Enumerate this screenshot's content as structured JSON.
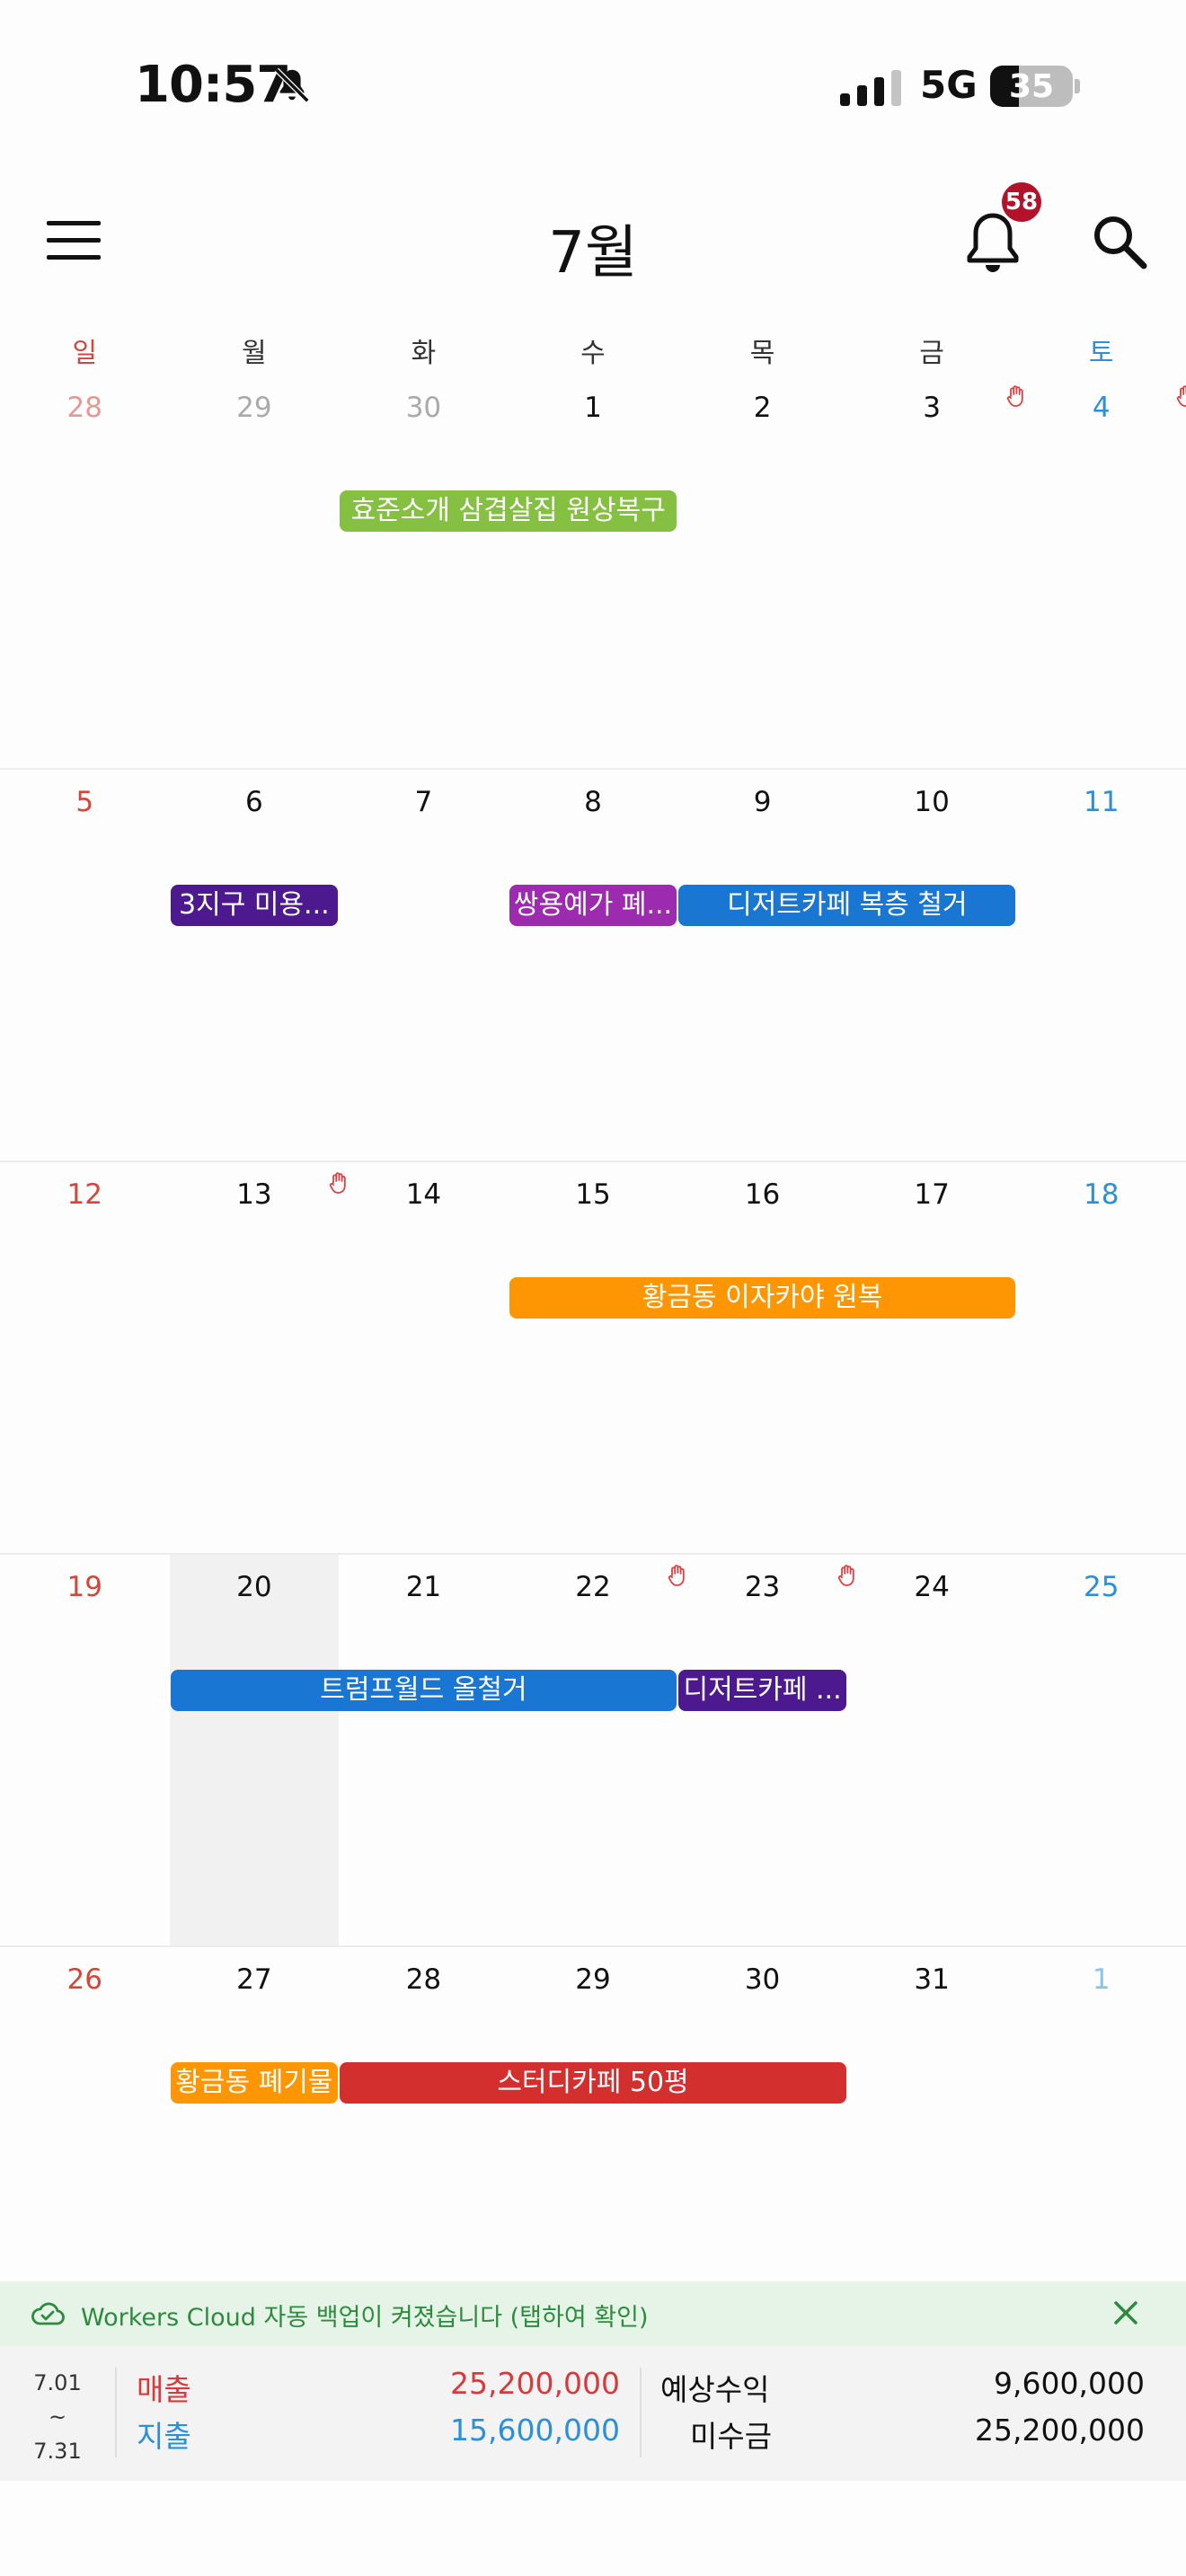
{
  "status_bar": {
    "time": "10:57",
    "network": "5G",
    "battery": "35",
    "battery_level": 0.35
  },
  "header": {
    "month": "7월",
    "notification_count": "58"
  },
  "weekdays": [
    "일",
    "월",
    "화",
    "수",
    "목",
    "금",
    "토"
  ],
  "weeks": [
    {
      "days": [
        {
          "num": "28",
          "other": true
        },
        {
          "num": "29",
          "other": true
        },
        {
          "num": "30",
          "other": true
        },
        {
          "num": "1"
        },
        {
          "num": "2"
        },
        {
          "num": "3",
          "hand": true
        },
        {
          "num": "4",
          "hand": true
        }
      ]
    },
    {
      "days": [
        {
          "num": "5"
        },
        {
          "num": "6"
        },
        {
          "num": "7"
        },
        {
          "num": "8"
        },
        {
          "num": "9"
        },
        {
          "num": "10"
        },
        {
          "num": "11"
        }
      ]
    },
    {
      "days": [
        {
          "num": "12"
        },
        {
          "num": "13",
          "hand": true
        },
        {
          "num": "14"
        },
        {
          "num": "15"
        },
        {
          "num": "16"
        },
        {
          "num": "17"
        },
        {
          "num": "18"
        }
      ]
    },
    {
      "days": [
        {
          "num": "19"
        },
        {
          "num": "20",
          "today": true
        },
        {
          "num": "21"
        },
        {
          "num": "22",
          "hand": true
        },
        {
          "num": "23",
          "hand": true
        },
        {
          "num": "24"
        },
        {
          "num": "25"
        }
      ]
    },
    {
      "days": [
        {
          "num": "26"
        },
        {
          "num": "27"
        },
        {
          "num": "28"
        },
        {
          "num": "29"
        },
        {
          "num": "30"
        },
        {
          "num": "31"
        },
        {
          "num": "1",
          "other": true
        }
      ]
    }
  ],
  "events": [
    {
      "title": "효준소개 삼겹살집 원상복구",
      "week": 0,
      "start": 2,
      "span": 2,
      "color": "#86c043"
    },
    {
      "title": "3지구 미용...",
      "week": 1,
      "start": 1,
      "span": 1,
      "color": "#4c1a8e"
    },
    {
      "title": "쌍용예가 폐...",
      "week": 1,
      "start": 3,
      "span": 1,
      "color": "#9c2bb0"
    },
    {
      "title": "디저트카페 복층 철거",
      "week": 1,
      "start": 4,
      "span": 2,
      "color": "#1976d2"
    },
    {
      "title": "황금동 이자카야 원복",
      "week": 2,
      "start": 3,
      "span": 3,
      "color": "#fd9602"
    },
    {
      "title": "트럼프월드 올철거",
      "week": 3,
      "start": 1,
      "span": 3,
      "color": "#1976d2"
    },
    {
      "title": "디저트카페 ...",
      "week": 3,
      "start": 4,
      "span": 1,
      "color": "#4c1a8e"
    },
    {
      "title": "황금동 폐기물",
      "week": 4,
      "start": 1,
      "span": 1,
      "color": "#fd9602"
    },
    {
      "title": "스터디카페 50평",
      "week": 4,
      "start": 2,
      "span": 3,
      "color": "#d32f2f"
    }
  ],
  "banner": {
    "message": "Workers Cloud 자동 백업이 켜졌습니다 (탭하여 확인)"
  },
  "summary": {
    "range_start": "7.01",
    "range_sep": "~",
    "range_end": "7.31",
    "sales_label": "매출",
    "sales_value": "25,200,000",
    "expense_label": "지출",
    "expense_value": "15,600,000",
    "expected_label": "예상수익",
    "expected_value": "9,600,000",
    "receivable_label": "미수금",
    "receivable_value": "25,200,000"
  },
  "colors": {
    "sunday": "#d4453a",
    "saturday": "#2f8fd6",
    "badge": "#b3122a",
    "banner_text": "#2e8b3e"
  }
}
